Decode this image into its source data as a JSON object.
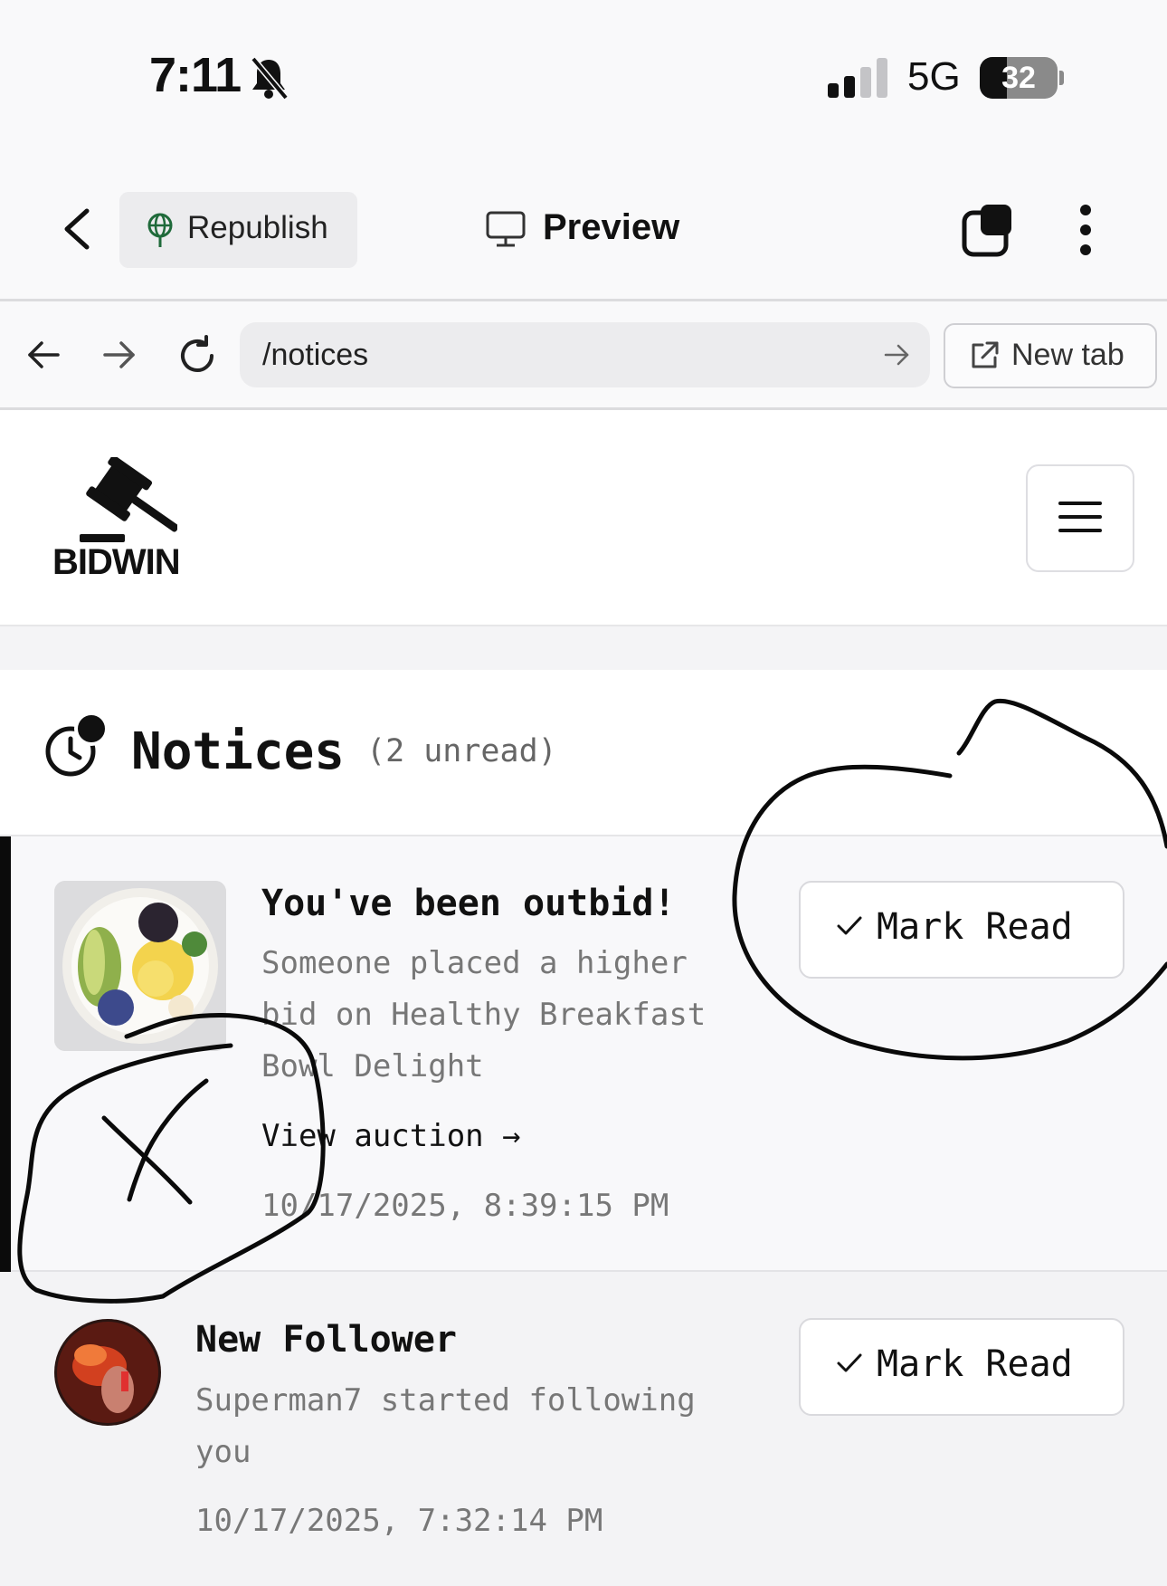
{
  "status_bar": {
    "time": "7:11",
    "network": "5G",
    "battery": "32"
  },
  "editor_toolbar": {
    "republish_label": "Republish",
    "preview_label": "Preview"
  },
  "browser_bar": {
    "url": "/notices",
    "new_tab_label": "New tab"
  },
  "site_header": {
    "brand": "BIDWIN"
  },
  "notices": {
    "title": "Notices",
    "unread": "(2 unread)",
    "items": [
      {
        "title": "You've been outbid!",
        "body_lines": [
          "Someone placed a higher",
          "bid on Healthy Breakfast",
          "Bowl Delight"
        ],
        "link": "View auction →",
        "date": "10/17/2025, 8:39:15 PM",
        "action": "Mark Read"
      },
      {
        "title": "New Follower",
        "body_lines": [
          "Superman7 started following",
          "you"
        ],
        "date": "10/17/2025, 7:32:14 PM",
        "action": "Mark Read"
      }
    ]
  }
}
